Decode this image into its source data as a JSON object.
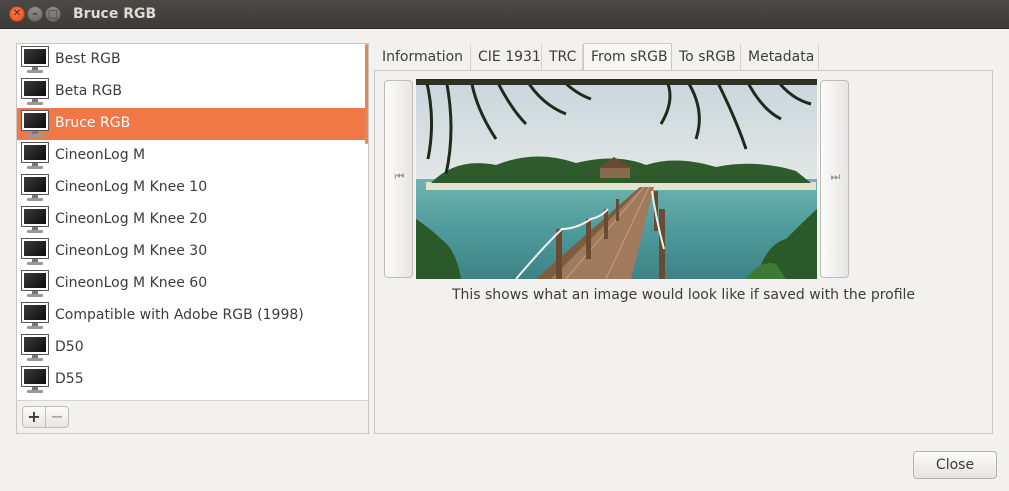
{
  "window": {
    "title": "Bruce RGB"
  },
  "profiles": [
    {
      "label": "Best RGB",
      "selected": false
    },
    {
      "label": "Beta RGB",
      "selected": false
    },
    {
      "label": "Bruce RGB",
      "selected": true
    },
    {
      "label": "CineonLog M",
      "selected": false
    },
    {
      "label": "CineonLog M Knee 10",
      "selected": false
    },
    {
      "label": "CineonLog M Knee 20",
      "selected": false
    },
    {
      "label": "CineonLog M Knee 30",
      "selected": false
    },
    {
      "label": "CineonLog M Knee 60",
      "selected": false
    },
    {
      "label": "Compatible with Adobe RGB (1998)",
      "selected": false
    },
    {
      "label": "D50",
      "selected": false
    },
    {
      "label": "D55",
      "selected": false
    }
  ],
  "list_toolbar": {
    "add_label": "+",
    "remove_label": "−"
  },
  "tabs": [
    {
      "label": "Information",
      "active": false
    },
    {
      "label": "CIE 1931",
      "active": false
    },
    {
      "label": "TRC",
      "active": false
    },
    {
      "label": "From sRGB",
      "active": true
    },
    {
      "label": "To sRGB",
      "active": false
    },
    {
      "label": "Metadata",
      "active": false
    }
  ],
  "preview": {
    "prev_icon": "⏮",
    "next_icon": "⏭",
    "caption": "This shows what an image would look like if saved with the profile"
  },
  "dialog": {
    "close_label": "Close"
  },
  "colors": {
    "accent": "#f07746",
    "titlebar": "#3c3b37"
  },
  "icons": {
    "profile": "display-icon",
    "close": "window-close-icon",
    "minimize": "window-minimize-icon",
    "maximize": "window-maximize-icon"
  }
}
